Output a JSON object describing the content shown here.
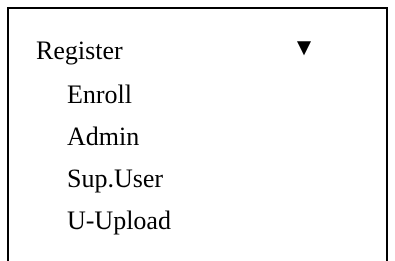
{
  "menu": {
    "title": "Register",
    "scroll_indicator": "▼",
    "scroll_indicator_icon": "triangle-down-icon",
    "items": [
      {
        "label": "Enroll"
      },
      {
        "label": "Admin"
      },
      {
        "label": "Sup.User"
      },
      {
        "label": "U-Upload"
      }
    ]
  }
}
